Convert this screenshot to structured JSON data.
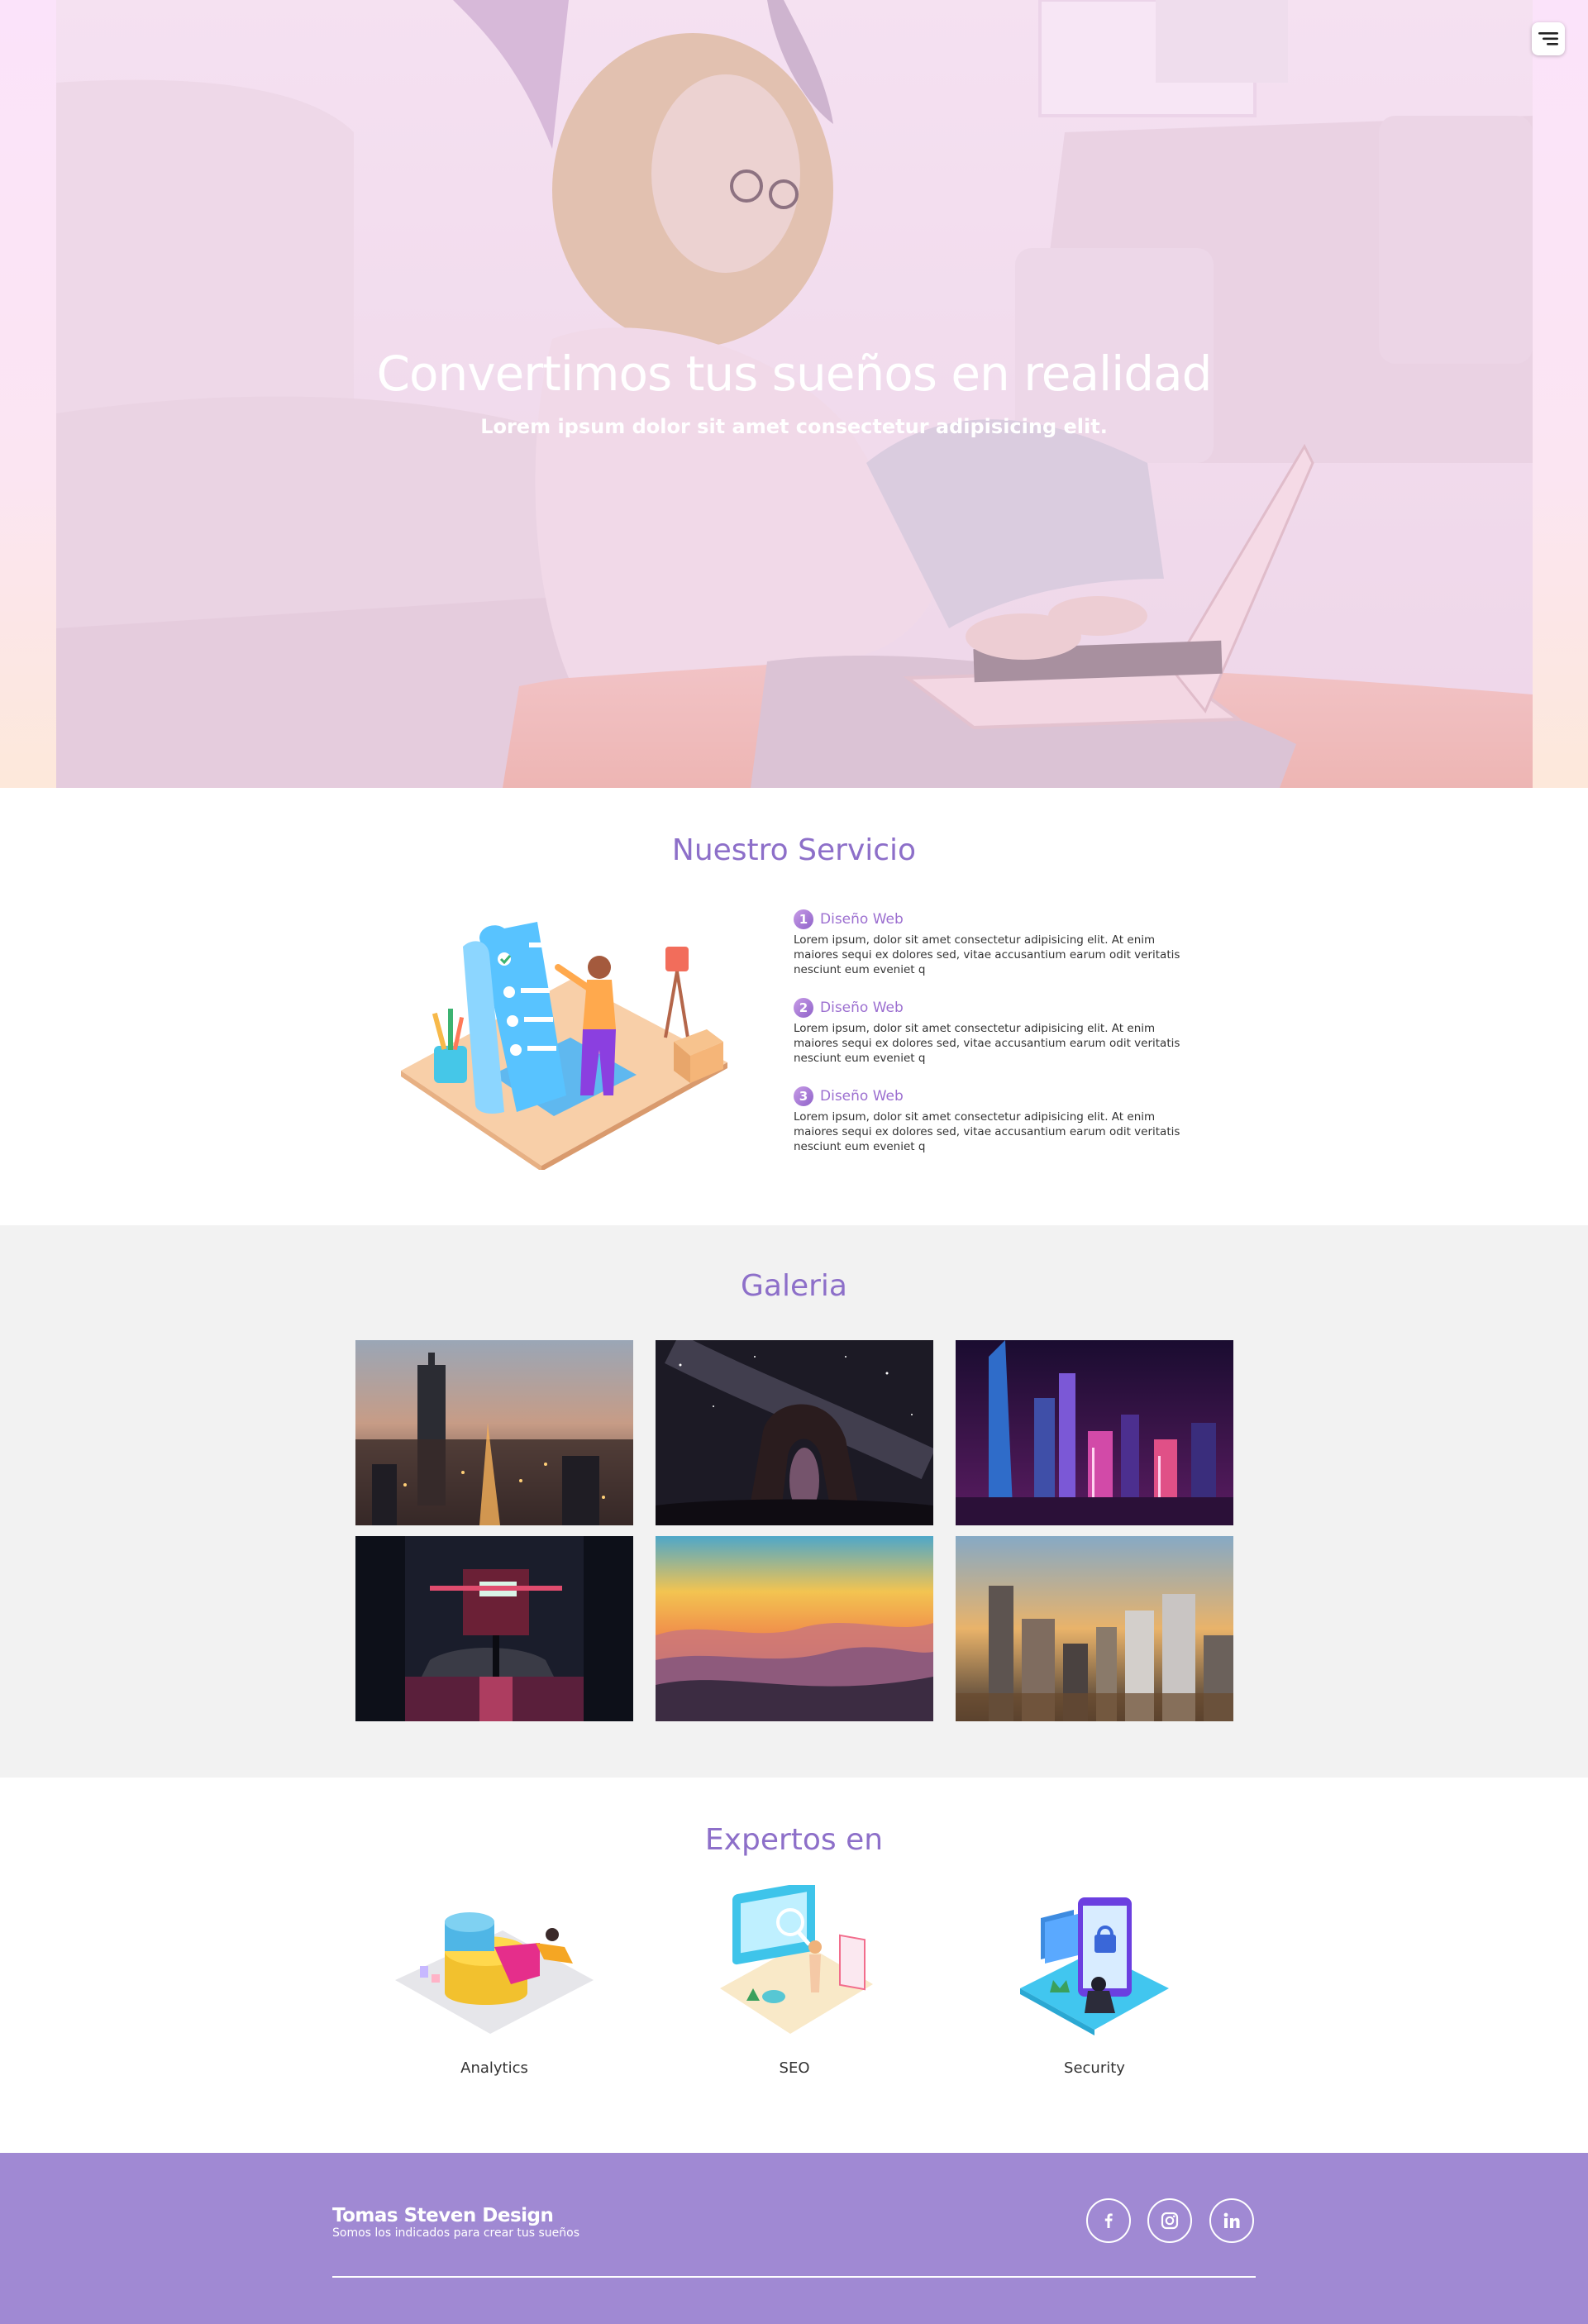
{
  "hero": {
    "title": "Convertimos tus sueños en realidad",
    "subtitle": "Lorem ipsum dolor sit amet consectetur adipisicing elit."
  },
  "nav": {
    "menu_icon": "menu-icon"
  },
  "services": {
    "title": "Nuestro Servicio",
    "items": [
      {
        "number": "1",
        "title": "Diseño Web",
        "text": "Lorem ipsum, dolor sit amet consectetur adipisicing elit. At enim maiores sequi ex dolores sed, vitae accusantium earum odit veritatis nesciunt eum eveniet q"
      },
      {
        "number": "2",
        "title": "Diseño Web",
        "text": "Lorem ipsum, dolor sit amet consectetur adipisicing elit. At enim maiores sequi ex dolores sed, vitae accusantium earum odit veritatis nesciunt eum eveniet q"
      },
      {
        "number": "3",
        "title": "Diseño Web",
        "text": "Lorem ipsum, dolor sit amet consectetur adipisicing elit. At enim maiores sequi ex dolores sed, vitae accusantium earum odit veritatis nesciunt eum eveniet q"
      }
    ]
  },
  "gallery": {
    "title": "Galeria",
    "images": [
      "city-night-aerial",
      "starry-rock-arch",
      "neon-skyline",
      "neon-alley-rain",
      "sunset-mountains",
      "golden-city-towers"
    ]
  },
  "experts": {
    "title": "Expertos en",
    "items": [
      {
        "label": "Analytics",
        "icon": "analytics-illustration"
      },
      {
        "label": "SEO",
        "icon": "seo-illustration"
      },
      {
        "label": "Security",
        "icon": "security-illustration"
      }
    ]
  },
  "footer": {
    "brand": "Tomas Steven Design",
    "tagline": "Somos los indicados para crear tus sueños",
    "social": [
      "facebook-icon",
      "instagram-icon",
      "linkedin-icon"
    ]
  },
  "colors": {
    "accent": "#8d6fc9",
    "footer_bg": "#a089d3",
    "gallery_bg": "#f2f2f2",
    "hero_overlay": "#fbe3fa"
  }
}
